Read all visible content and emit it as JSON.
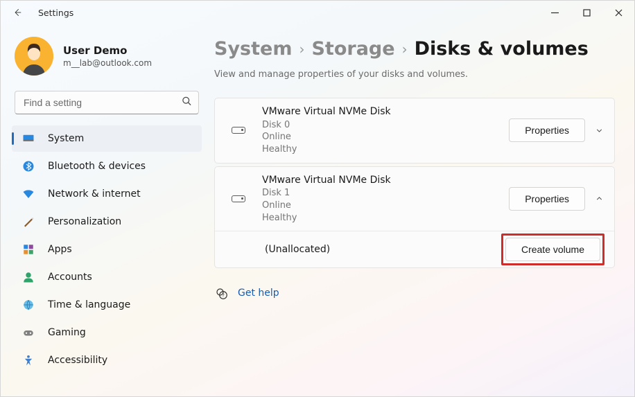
{
  "app": {
    "title": "Settings"
  },
  "user": {
    "name": "User Demo",
    "email": "m__lab@outlook.com"
  },
  "search": {
    "placeholder": "Find a setting"
  },
  "sidebar": {
    "items": [
      {
        "label": "System"
      },
      {
        "label": "Bluetooth & devices"
      },
      {
        "label": "Network & internet"
      },
      {
        "label": "Personalization"
      },
      {
        "label": "Apps"
      },
      {
        "label": "Accounts"
      },
      {
        "label": "Time & language"
      },
      {
        "label": "Gaming"
      },
      {
        "label": "Accessibility"
      }
    ]
  },
  "breadcrumbs": [
    "System",
    "Storage",
    "Disks & volumes"
  ],
  "page": {
    "description": "View and manage properties of your disks and volumes."
  },
  "disks": [
    {
      "title": "VMware Virtual NVMe Disk",
      "name": "Disk 0",
      "state": "Online",
      "health": "Healthy",
      "properties_label": "Properties",
      "expanded": false
    },
    {
      "title": "VMware Virtual NVMe Disk",
      "name": "Disk 1",
      "state": "Online",
      "health": "Healthy",
      "properties_label": "Properties",
      "expanded": true,
      "volume": {
        "label": "(Unallocated)",
        "action_label": "Create volume"
      }
    }
  ],
  "help": {
    "label": "Get help"
  }
}
